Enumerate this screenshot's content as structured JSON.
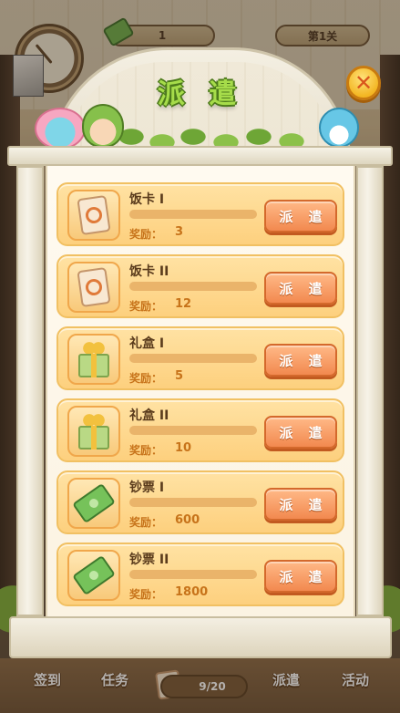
{
  "hud": {
    "money_value": "1",
    "level_label": "第1关"
  },
  "modal": {
    "title": "派 遣",
    "close_symbol": "✕",
    "reward_label": "奖励：",
    "send_label": "派 遣",
    "items": [
      {
        "name": "饭卡 I",
        "reward": "3",
        "icon": "meal-card-icon"
      },
      {
        "name": "饭卡 II",
        "reward": "12",
        "icon": "meal-card-icon"
      },
      {
        "name": "礼盒 I",
        "reward": "5",
        "icon": "gift-box-icon"
      },
      {
        "name": "礼盒 II",
        "reward": "10",
        "icon": "gift-box-icon"
      },
      {
        "name": "钞票 I",
        "reward": "600",
        "icon": "cash-icon"
      },
      {
        "name": "钞票 II",
        "reward": "1800",
        "icon": "cash-icon"
      }
    ]
  },
  "bottom_nav": {
    "sign_in": "签到",
    "tasks": "任务",
    "progress": "9/20",
    "dispatch": "派遣",
    "activity": "活动"
  },
  "colors": {
    "title_green": "#a6dc4a",
    "row_bg": "#fdd07e",
    "send_button": "#f2894f",
    "reward_text": "#c7731a"
  }
}
